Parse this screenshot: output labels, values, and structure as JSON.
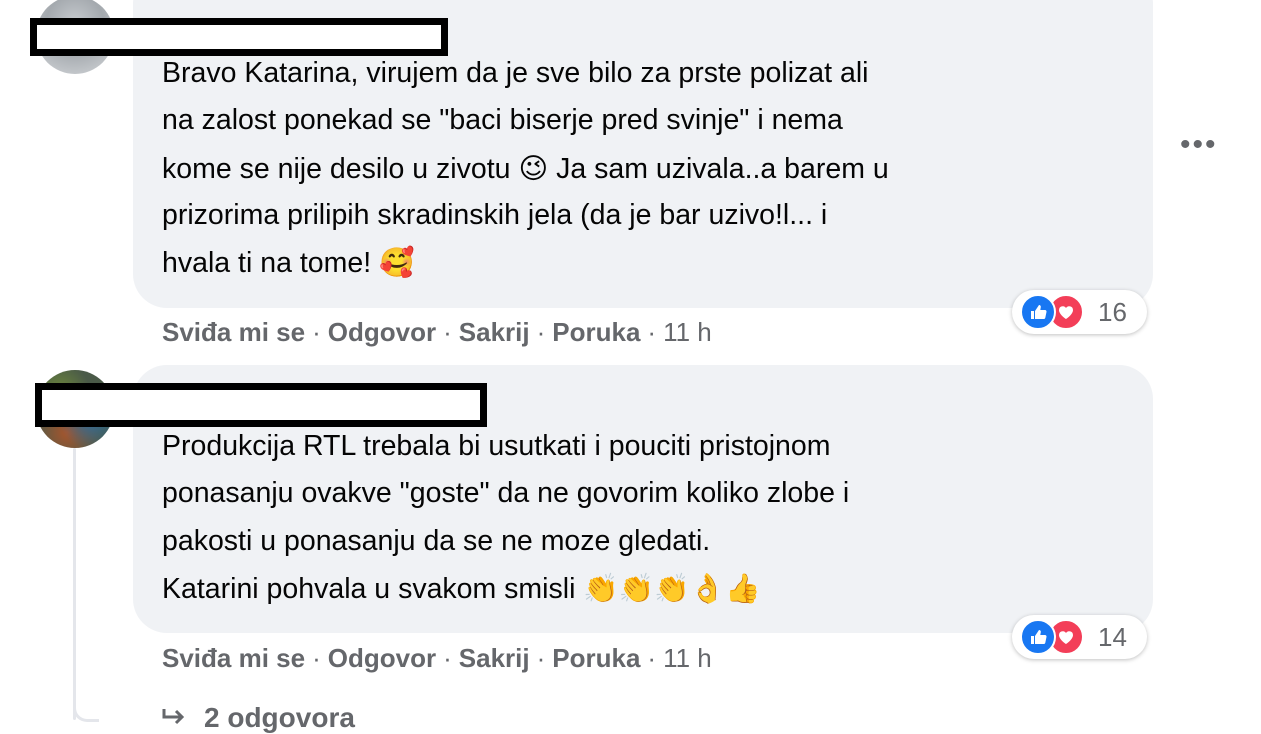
{
  "comments": [
    {
      "lines": [
        "Bravo Katarina, virujem da je sve bilo za prste polizat ali",
        "na zalost ponekad se \"baci biserje pred svinje\" i nema",
        "kome se nije desilo u zivotu",
        "Ja sam uzivala..a barem u",
        "prizorima prilipih skradinskih jela (da je bar uzivo!l... i",
        "hvala ti na tome!"
      ],
      "emoji_wink": "😉",
      "emoji_love": "🥰",
      "reaction_count": "16",
      "actions": {
        "like": "Sviđa mi se",
        "reply": "Odgovor",
        "hide": "Sakrij",
        "message": "Poruka",
        "time": "11 h"
      }
    },
    {
      "lines": [
        "Produkcija RTL trebala bi usutkati i pouciti pristojnom",
        "ponasanju ovakve \"goste\" da ne govorim koliko zlobe i",
        "pakosti u ponasanju da se ne moze gledati.",
        "Katarini pohvala u svakom smisli"
      ],
      "emojis_end": "👏👏👏👌👍",
      "reaction_count": "14",
      "actions": {
        "like": "Sviđa mi se",
        "reply": "Odgovor",
        "hide": "Sakrij",
        "message": "Poruka",
        "time": "11 h"
      }
    }
  ],
  "more_label": "•••",
  "replies_label": "2 odgovora",
  "separator": "·",
  "icons": {
    "like": "like-icon",
    "love": "love-icon",
    "more": "more-options-icon",
    "reply_arrow": "reply-arrow-icon"
  },
  "colors": {
    "bubble": "#f0f2f5",
    "like": "#1877f2",
    "love": "#f33e58",
    "meta": "#65676b"
  }
}
